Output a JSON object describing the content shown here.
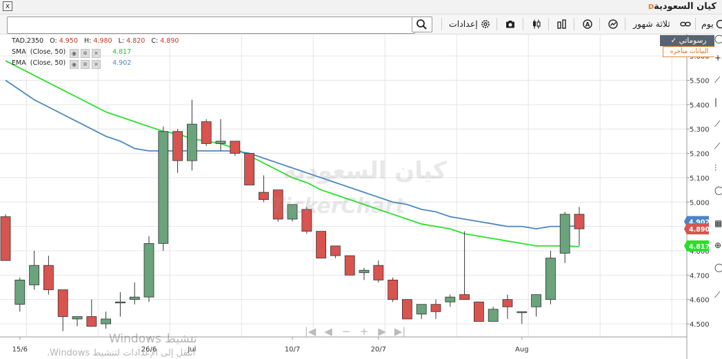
{
  "window": {
    "title": "كيان السعودية",
    "badge": "D",
    "close_glyph": "x"
  },
  "toolbar": {
    "period": "يوم",
    "range": "ثلاثة شهور",
    "settings": "إعدادات",
    "search_value": ""
  },
  "realtime": {
    "button": "رسوماتي",
    "delayed": "البيانات متأخره"
  },
  "legend": {
    "ohlc": {
      "symbol": "TAD.2350",
      "o_label": "O:",
      "o": "4.950",
      "h_label": "H:",
      "h": "4.980",
      "l_label": "L:",
      "l": "4.820",
      "c_label": "C:",
      "c": "4.890"
    },
    "sma": {
      "label": "SMA",
      "params": "(Close, 50)",
      "value": "4.817"
    },
    "ema": {
      "label": "EMA",
      "params": "(Close, 50)",
      "value": "4.902"
    }
  },
  "watermark": {
    "arabic": "كيان السعودية",
    "brand": "TickerChart"
  },
  "activation": {
    "line1": "تنشيط Windows",
    "line2": "انتقل إلى الإعدادات لتنشيط Windows."
  },
  "colors": {
    "up": "#6aa37c",
    "down": "#d9534f",
    "sma": "#27e02b",
    "ema": "#4a86c0",
    "grid": "#e4e4e4"
  },
  "chart_data": {
    "type": "candlestick",
    "y_ticks": [
      "4.500",
      "4.600",
      "4.700",
      "4.800",
      "4.900",
      "5.000",
      "5.100",
      "5.200",
      "5.300",
      "5.400",
      "5.500",
      "5.600"
    ],
    "ylim": [
      4.47,
      5.62
    ],
    "x_labels": [
      {
        "label": "15/6",
        "index": 1
      },
      {
        "label": "26/6",
        "index": 10
      },
      {
        "label": "Jul",
        "index": 13
      },
      {
        "label": "10/7",
        "index": 20
      },
      {
        "label": "20/7",
        "index": 26
      },
      {
        "label": "Aug",
        "index": 36
      }
    ],
    "candles": [
      {
        "o": 4.94,
        "h": 4.95,
        "l": 4.76,
        "c": 4.76
      },
      {
        "o": 4.58,
        "h": 4.69,
        "l": 4.55,
        "c": 4.68
      },
      {
        "o": 4.66,
        "h": 4.8,
        "l": 4.64,
        "c": 4.74
      },
      {
        "o": 4.74,
        "h": 4.78,
        "l": 4.62,
        "c": 4.64
      },
      {
        "o": 4.64,
        "h": 4.64,
        "l": 4.47,
        "c": 4.53
      },
      {
        "o": 4.52,
        "h": 4.53,
        "l": 4.49,
        "c": 4.53
      },
      {
        "o": 4.53,
        "h": 4.6,
        "l": 4.5,
        "c": 4.49
      },
      {
        "o": 4.5,
        "h": 4.55,
        "l": 4.48,
        "c": 4.52
      },
      {
        "o": 4.59,
        "h": 4.63,
        "l": 4.53,
        "c": 4.59
      },
      {
        "o": 4.6,
        "h": 4.67,
        "l": 4.58,
        "c": 4.61
      },
      {
        "o": 4.61,
        "h": 4.86,
        "l": 4.59,
        "c": 4.83
      },
      {
        "o": 4.83,
        "h": 5.31,
        "l": 4.8,
        "c": 5.29
      },
      {
        "o": 5.29,
        "h": 5.3,
        "l": 5.12,
        "c": 5.17
      },
      {
        "o": 5.17,
        "h": 5.42,
        "l": 5.13,
        "c": 5.32
      },
      {
        "o": 5.33,
        "h": 5.34,
        "l": 5.23,
        "c": 5.24
      },
      {
        "o": 5.24,
        "h": 5.34,
        "l": 5.21,
        "c": 5.25
      },
      {
        "o": 5.25,
        "h": 5.25,
        "l": 5.19,
        "c": 5.2
      },
      {
        "o": 5.2,
        "h": 5.2,
        "l": 5.07,
        "c": 5.07
      },
      {
        "o": 5.04,
        "h": 5.11,
        "l": 5.0,
        "c": 5.01
      },
      {
        "o": 5.05,
        "h": 5.05,
        "l": 4.92,
        "c": 4.93
      },
      {
        "o": 4.93,
        "h": 4.98,
        "l": 4.92,
        "c": 4.99
      },
      {
        "o": 4.97,
        "h": 4.98,
        "l": 4.87,
        "c": 4.88
      },
      {
        "o": 4.88,
        "h": 4.88,
        "l": 4.77,
        "c": 4.77
      },
      {
        "o": 4.82,
        "h": 4.82,
        "l": 4.77,
        "c": 4.78
      },
      {
        "o": 4.78,
        "h": 4.78,
        "l": 4.7,
        "c": 4.7
      },
      {
        "o": 4.71,
        "h": 4.73,
        "l": 4.68,
        "c": 4.72
      },
      {
        "o": 4.74,
        "h": 4.76,
        "l": 4.67,
        "c": 4.68
      },
      {
        "o": 4.68,
        "h": 4.69,
        "l": 4.59,
        "c": 4.6
      },
      {
        "o": 4.6,
        "h": 4.6,
        "l": 4.52,
        "c": 4.52
      },
      {
        "o": 4.54,
        "h": 4.58,
        "l": 4.52,
        "c": 4.58
      },
      {
        "o": 4.58,
        "h": 4.6,
        "l": 4.52,
        "c": 4.55
      },
      {
        "o": 4.59,
        "h": 4.62,
        "l": 4.57,
        "c": 4.61
      },
      {
        "o": 4.62,
        "h": 4.88,
        "l": 4.6,
        "c": 4.6
      },
      {
        "o": 4.59,
        "h": 4.59,
        "l": 4.51,
        "c": 4.51
      },
      {
        "o": 4.51,
        "h": 4.57,
        "l": 4.51,
        "c": 4.56
      },
      {
        "o": 4.6,
        "h": 4.62,
        "l": 4.52,
        "c": 4.57
      },
      {
        "o": 4.55,
        "h": 4.55,
        "l": 4.5,
        "c": 4.55
      },
      {
        "o": 4.57,
        "h": 4.62,
        "l": 4.53,
        "c": 4.62
      },
      {
        "o": 4.6,
        "h": 4.8,
        "l": 4.58,
        "c": 4.77
      },
      {
        "o": 4.79,
        "h": 4.96,
        "l": 4.75,
        "c": 4.95
      },
      {
        "o": 4.95,
        "h": 4.98,
        "l": 4.82,
        "c": 4.89
      }
    ],
    "series": [
      {
        "name": "SMA",
        "values": [
          5.58,
          5.55,
          5.52,
          5.49,
          5.46,
          5.43,
          5.4,
          5.37,
          5.35,
          5.33,
          5.31,
          5.29,
          5.28,
          5.26,
          5.25,
          5.24,
          5.22,
          5.19,
          5.16,
          5.13,
          5.1,
          5.08,
          5.05,
          5.03,
          5.01,
          4.99,
          4.97,
          4.95,
          4.93,
          4.91,
          4.9,
          4.89,
          4.87,
          4.86,
          4.85,
          4.84,
          4.83,
          4.82,
          4.82,
          4.82,
          4.817
        ]
      },
      {
        "name": "EMA",
        "values": [
          5.5,
          5.46,
          5.42,
          5.39,
          5.36,
          5.33,
          5.3,
          5.27,
          5.25,
          5.22,
          5.21,
          5.21,
          5.21,
          5.21,
          5.21,
          5.21,
          5.21,
          5.2,
          5.18,
          5.16,
          5.14,
          5.12,
          5.1,
          5.08,
          5.06,
          5.04,
          5.02,
          5.0,
          4.99,
          4.97,
          4.96,
          4.94,
          4.93,
          4.92,
          4.91,
          4.9,
          4.9,
          4.89,
          4.9,
          4.9,
          4.902
        ]
      }
    ],
    "badges": [
      {
        "series": "EMA",
        "value": "4.902",
        "price": 4.92,
        "color": "#4a86c0"
      },
      {
        "series": "Close",
        "value": "4.890",
        "price": 4.89,
        "color": "#d9534f"
      },
      {
        "series": "SMA",
        "value": "4.817",
        "price": 4.82,
        "color": "#27e02b"
      }
    ]
  }
}
